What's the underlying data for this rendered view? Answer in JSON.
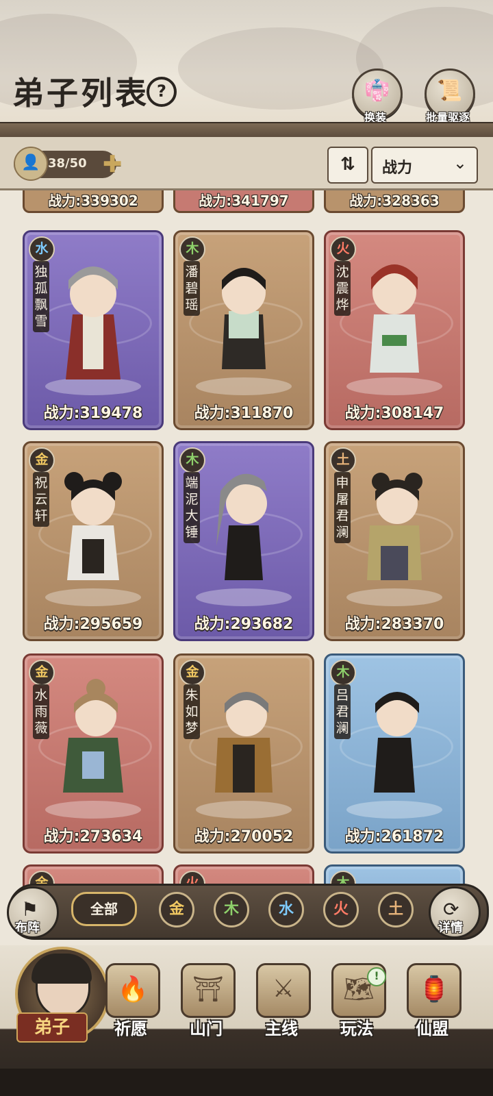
{
  "header": {
    "title": "弟子列表",
    "help_label": "?",
    "buttons": [
      {
        "label": "换装",
        "icon": "outfit-icon"
      },
      {
        "label": "批量驱逐",
        "icon": "expel-scroll-icon"
      }
    ]
  },
  "toolbar": {
    "count": "38/50",
    "sort_label": "战力"
  },
  "partial_top_row": [
    {
      "power": "战力:339302"
    },
    {
      "power": "战力:341797"
    },
    {
      "power": "战力:328363"
    }
  ],
  "disciples": [
    {
      "element": "水",
      "element_key": "water",
      "name": "独孤飘雪",
      "power": "战力:319478",
      "bg": "purple"
    },
    {
      "element": "木",
      "element_key": "wood",
      "name": "潘碧瑶",
      "power": "战力:311870",
      "bg": "brown"
    },
    {
      "element": "火",
      "element_key": "fire",
      "name": "沈震烨",
      "power": "战力:308147",
      "bg": "red"
    },
    {
      "element": "金",
      "element_key": "metal",
      "name": "祝云轩",
      "power": "战力:295659",
      "bg": "brown"
    },
    {
      "element": "木",
      "element_key": "wood",
      "name": "端泥大锤",
      "power": "战力:293682",
      "bg": "purple"
    },
    {
      "element": "土",
      "element_key": "earth",
      "name": "申屠君澜",
      "power": "战力:283370",
      "bg": "brown"
    },
    {
      "element": "金",
      "element_key": "metal",
      "name": "水雨薇",
      "power": "战力:273634",
      "bg": "red"
    },
    {
      "element": "金",
      "element_key": "metal",
      "name": "朱如梦",
      "power": "战力:270052",
      "bg": "brown"
    },
    {
      "element": "木",
      "element_key": "wood",
      "name": "吕君澜",
      "power": "战力:261872",
      "bg": "blue"
    }
  ],
  "partial_bottom_row": [
    {
      "element": "金",
      "element_key": "metal"
    },
    {
      "element": "火",
      "element_key": "fire"
    },
    {
      "element": "木",
      "element_key": "wood"
    }
  ],
  "element_filter": {
    "all_label": "全部",
    "elements": [
      {
        "label": "金",
        "key": "metal"
      },
      {
        "label": "木",
        "key": "wood"
      },
      {
        "label": "水",
        "key": "water"
      },
      {
        "label": "火",
        "key": "fire"
      },
      {
        "label": "土",
        "key": "earth"
      }
    ],
    "left_button": "布阵",
    "right_button": "详情"
  },
  "bottom_nav": [
    {
      "label": "弟子",
      "active": true
    },
    {
      "label": "祈愿"
    },
    {
      "label": "山门"
    },
    {
      "label": "主线"
    },
    {
      "label": "玩法",
      "badge": "!"
    },
    {
      "label": "仙盟"
    }
  ],
  "colors": {
    "purple_card": "#7b68b8",
    "brown_card": "#b8936c",
    "red_card": "#c67a72",
    "blue_card": "#8cb3d6",
    "wood": "#8ed06b",
    "water": "#7ecbff",
    "fire": "#ff7b66",
    "metal": "#f2c962",
    "earth": "#e7b37a"
  }
}
